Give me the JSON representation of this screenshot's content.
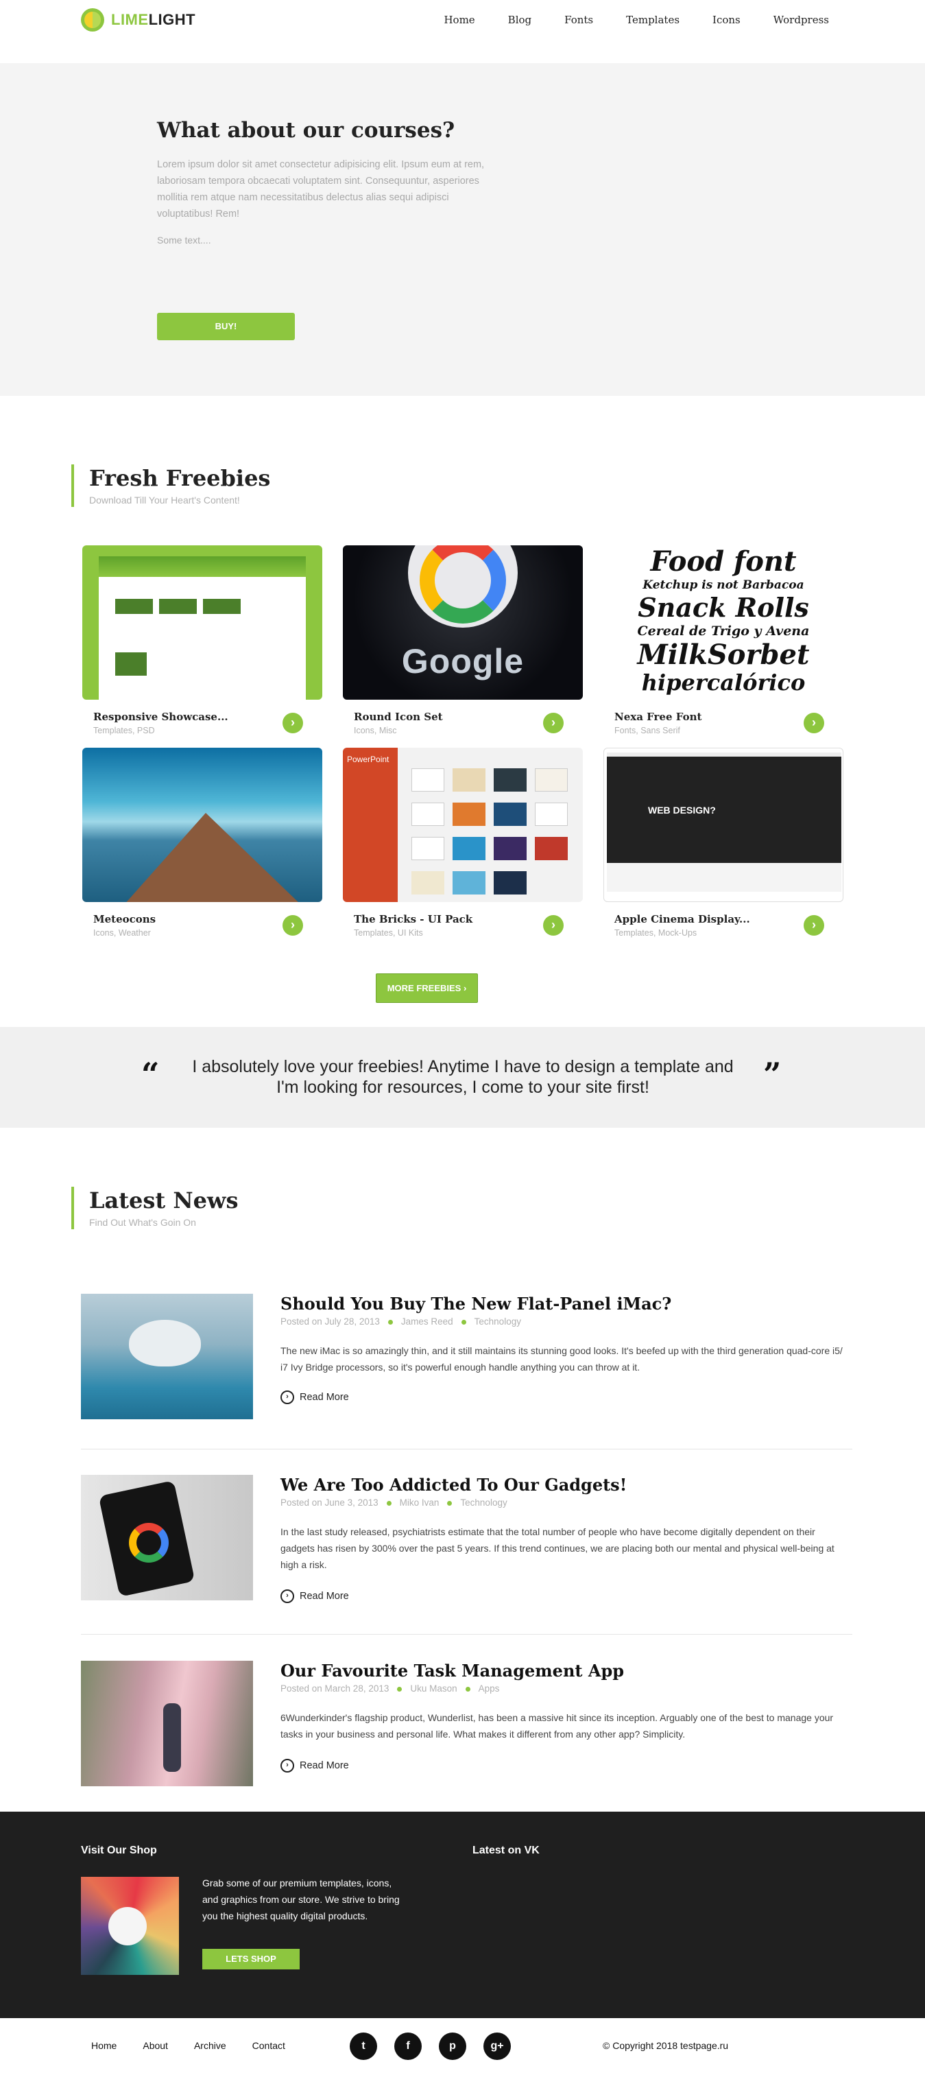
{
  "header": {
    "logo_lime": "LIME",
    "logo_light": "LIGHT",
    "nav": [
      "Home",
      "Blog",
      "Fonts",
      "Templates",
      "Icons",
      "Wordpress"
    ]
  },
  "hero": {
    "title": "What about our courses?",
    "text": "Lorem ipsum dolor sit amet consectetur adipisicing elit. Ipsum eum at rem, laboriosam tempora obcaecati voluptatem sint. Consequuntur, asperiores mollitia rem atque nam necessitatibus delectus alias sequi adipisci voluptatibus! Rem!",
    "sub": "Some text....",
    "button": "BUY!"
  },
  "freebies": {
    "title": "Fresh Freebies",
    "subtitle": "Download Till Your Heart's Content!",
    "items": [
      {
        "title": "Responsive Showcase...",
        "tags": "Templates, PSD"
      },
      {
        "title": "Round Icon Set",
        "tags": "Icons, Misc"
      },
      {
        "title": "Nexa Free Font",
        "tags": "Fonts, Sans Serif"
      },
      {
        "title": "Meteocons",
        "tags": "Icons, Weather"
      },
      {
        "title": "The Bricks - UI Pack",
        "tags": "Templates, UI Kits"
      },
      {
        "title": "Apple Cinema Display...",
        "tags": "Templates, Mock-Ups"
      }
    ],
    "thumb_texts": {
      "google_word": "Google",
      "font_lines": [
        "Food font",
        "Ketchup is not Barbacoa",
        "Snack Rolls",
        "Cereal de Trigo y Avena",
        "MilkSorbet",
        "hipercalórico"
      ],
      "pp_label": "PowerPoint",
      "apple_headline": "WEB DESIGN?"
    },
    "more_button": "MORE FREEBIES ›"
  },
  "testimonial": {
    "open_quote": "“",
    "close_quote": "”",
    "text": "I absolutely love your freebies! Anytime I have to design a template and I'm looking for resources, I come to your site first!"
  },
  "news": {
    "title": "Latest News",
    "subtitle": "Find Out What's Goin On",
    "read_more": "Read More",
    "posts": [
      {
        "title": "Should You Buy The New Flat-Panel iMac?",
        "date": "Posted on July 28, 2013",
        "author": "James Reed",
        "category": "Technology",
        "body": "The new iMac is so amazingly thin, and it still maintains its stunning good looks. It's beefed up with the third generation quad-core i5/ i7 Ivy Bridge processors, so it's powerful enough handle anything you can throw at it."
      },
      {
        "title": "We Are Too Addicted To Our Gadgets!",
        "date": "Posted on June 3, 2013",
        "author": "Miko Ivan",
        "category": "Technology",
        "body": "In the last study released, psychiatrists estimate that the total number of people who have become digitally dependent on their gadgets has risen by 300% over the past 5 years. If this trend continues, we are placing both our mental and physical well-being at high a risk."
      },
      {
        "title": "Our Favourite Task Management App",
        "date": "Posted on March 28, 2013",
        "author": "Uku Mason",
        "category": "Apps",
        "body": "6Wunderkinder's flagship product, Wunderlist, has been a massive hit since its inception. Arguably one of the best to manage your tasks in your business and personal life. What makes it different from any other app? Simplicity."
      }
    ]
  },
  "footer": {
    "shop_title": "Visit Our Shop",
    "vk_title": "Latest on VK",
    "shop_text": "Grab some of our premium templates, icons, and graphics from our store. We strive to bring you the highest quality digital products.",
    "shop_button": "LETS SHOP",
    "bottom_nav": [
      "Home",
      "About",
      "Archive",
      "Contact"
    ],
    "social": [
      {
        "icon": "twitter-icon",
        "glyph": "t"
      },
      {
        "icon": "facebook-icon",
        "glyph": "f"
      },
      {
        "icon": "pinterest-icon",
        "glyph": "p"
      },
      {
        "icon": "google-plus-icon",
        "glyph": "g+"
      }
    ],
    "copyright": "© Copyright 2018 testpage.ru"
  },
  "colors": {
    "accent": "#8dc63f",
    "footer_bg": "#1f1f1f",
    "hero_bg": "#f4f4f4"
  }
}
